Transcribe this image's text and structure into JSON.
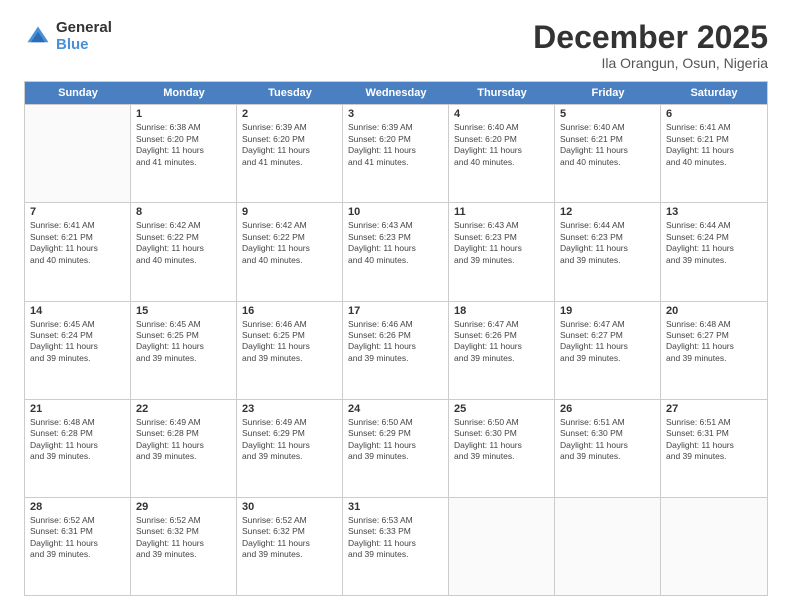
{
  "logo": {
    "general": "General",
    "blue": "Blue"
  },
  "title": "December 2025",
  "location": "Ila Orangun, Osun, Nigeria",
  "days_of_week": [
    "Sunday",
    "Monday",
    "Tuesday",
    "Wednesday",
    "Thursday",
    "Friday",
    "Saturday"
  ],
  "weeks": [
    [
      {
        "day": "",
        "info": ""
      },
      {
        "day": "1",
        "info": "Sunrise: 6:38 AM\nSunset: 6:20 PM\nDaylight: 11 hours\nand 41 minutes."
      },
      {
        "day": "2",
        "info": "Sunrise: 6:39 AM\nSunset: 6:20 PM\nDaylight: 11 hours\nand 41 minutes."
      },
      {
        "day": "3",
        "info": "Sunrise: 6:39 AM\nSunset: 6:20 PM\nDaylight: 11 hours\nand 41 minutes."
      },
      {
        "day": "4",
        "info": "Sunrise: 6:40 AM\nSunset: 6:20 PM\nDaylight: 11 hours\nand 40 minutes."
      },
      {
        "day": "5",
        "info": "Sunrise: 6:40 AM\nSunset: 6:21 PM\nDaylight: 11 hours\nand 40 minutes."
      },
      {
        "day": "6",
        "info": "Sunrise: 6:41 AM\nSunset: 6:21 PM\nDaylight: 11 hours\nand 40 minutes."
      }
    ],
    [
      {
        "day": "7",
        "info": "Sunrise: 6:41 AM\nSunset: 6:21 PM\nDaylight: 11 hours\nand 40 minutes."
      },
      {
        "day": "8",
        "info": "Sunrise: 6:42 AM\nSunset: 6:22 PM\nDaylight: 11 hours\nand 40 minutes."
      },
      {
        "day": "9",
        "info": "Sunrise: 6:42 AM\nSunset: 6:22 PM\nDaylight: 11 hours\nand 40 minutes."
      },
      {
        "day": "10",
        "info": "Sunrise: 6:43 AM\nSunset: 6:23 PM\nDaylight: 11 hours\nand 40 minutes."
      },
      {
        "day": "11",
        "info": "Sunrise: 6:43 AM\nSunset: 6:23 PM\nDaylight: 11 hours\nand 39 minutes."
      },
      {
        "day": "12",
        "info": "Sunrise: 6:44 AM\nSunset: 6:23 PM\nDaylight: 11 hours\nand 39 minutes."
      },
      {
        "day": "13",
        "info": "Sunrise: 6:44 AM\nSunset: 6:24 PM\nDaylight: 11 hours\nand 39 minutes."
      }
    ],
    [
      {
        "day": "14",
        "info": "Sunrise: 6:45 AM\nSunset: 6:24 PM\nDaylight: 11 hours\nand 39 minutes."
      },
      {
        "day": "15",
        "info": "Sunrise: 6:45 AM\nSunset: 6:25 PM\nDaylight: 11 hours\nand 39 minutes."
      },
      {
        "day": "16",
        "info": "Sunrise: 6:46 AM\nSunset: 6:25 PM\nDaylight: 11 hours\nand 39 minutes."
      },
      {
        "day": "17",
        "info": "Sunrise: 6:46 AM\nSunset: 6:26 PM\nDaylight: 11 hours\nand 39 minutes."
      },
      {
        "day": "18",
        "info": "Sunrise: 6:47 AM\nSunset: 6:26 PM\nDaylight: 11 hours\nand 39 minutes."
      },
      {
        "day": "19",
        "info": "Sunrise: 6:47 AM\nSunset: 6:27 PM\nDaylight: 11 hours\nand 39 minutes."
      },
      {
        "day": "20",
        "info": "Sunrise: 6:48 AM\nSunset: 6:27 PM\nDaylight: 11 hours\nand 39 minutes."
      }
    ],
    [
      {
        "day": "21",
        "info": "Sunrise: 6:48 AM\nSunset: 6:28 PM\nDaylight: 11 hours\nand 39 minutes."
      },
      {
        "day": "22",
        "info": "Sunrise: 6:49 AM\nSunset: 6:28 PM\nDaylight: 11 hours\nand 39 minutes."
      },
      {
        "day": "23",
        "info": "Sunrise: 6:49 AM\nSunset: 6:29 PM\nDaylight: 11 hours\nand 39 minutes."
      },
      {
        "day": "24",
        "info": "Sunrise: 6:50 AM\nSunset: 6:29 PM\nDaylight: 11 hours\nand 39 minutes."
      },
      {
        "day": "25",
        "info": "Sunrise: 6:50 AM\nSunset: 6:30 PM\nDaylight: 11 hours\nand 39 minutes."
      },
      {
        "day": "26",
        "info": "Sunrise: 6:51 AM\nSunset: 6:30 PM\nDaylight: 11 hours\nand 39 minutes."
      },
      {
        "day": "27",
        "info": "Sunrise: 6:51 AM\nSunset: 6:31 PM\nDaylight: 11 hours\nand 39 minutes."
      }
    ],
    [
      {
        "day": "28",
        "info": "Sunrise: 6:52 AM\nSunset: 6:31 PM\nDaylight: 11 hours\nand 39 minutes."
      },
      {
        "day": "29",
        "info": "Sunrise: 6:52 AM\nSunset: 6:32 PM\nDaylight: 11 hours\nand 39 minutes."
      },
      {
        "day": "30",
        "info": "Sunrise: 6:52 AM\nSunset: 6:32 PM\nDaylight: 11 hours\nand 39 minutes."
      },
      {
        "day": "31",
        "info": "Sunrise: 6:53 AM\nSunset: 6:33 PM\nDaylight: 11 hours\nand 39 minutes."
      },
      {
        "day": "",
        "info": ""
      },
      {
        "day": "",
        "info": ""
      },
      {
        "day": "",
        "info": ""
      }
    ]
  ]
}
